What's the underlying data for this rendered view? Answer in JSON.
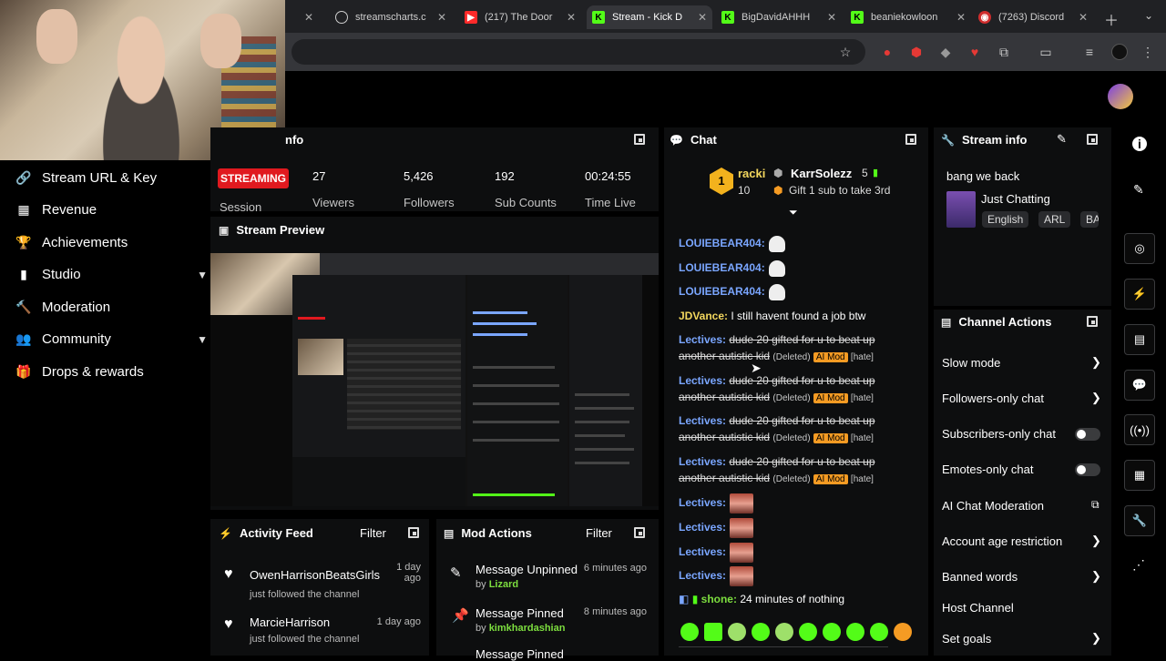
{
  "browser": {
    "tabs": [
      {
        "title": "streamscharts.c",
        "icon": "streamscharts-icon",
        "color": "#cfcfcf"
      },
      {
        "title": "(217) The Door",
        "icon": "youtube-icon",
        "color": "#ff2a2a"
      },
      {
        "title": "Stream - Kick D",
        "icon": "kick-icon",
        "color": "#53fc18"
      },
      {
        "title": "BigDavidAHHH",
        "icon": "kick-icon",
        "color": "#53fc18"
      },
      {
        "title": "beaniekowloon",
        "icon": "kick-icon",
        "color": "#53fc18"
      },
      {
        "title": "(7263) Discord",
        "icon": "discord-icon",
        "color": "#d02d2d"
      }
    ]
  },
  "sidebar": {
    "items": [
      {
        "label": "Stream URL & Key",
        "icon": "link-icon"
      },
      {
        "label": "Revenue",
        "icon": "revenue-icon"
      },
      {
        "label": "Achievements",
        "icon": "trophy-icon"
      },
      {
        "label": "Studio",
        "icon": "studio-icon",
        "chevron": true
      },
      {
        "label": "Moderation",
        "icon": "hammer-icon"
      },
      {
        "label": "Community",
        "icon": "community-icon",
        "chevron": true
      },
      {
        "label": "Drops & rewards",
        "icon": "gift-icon"
      }
    ]
  },
  "session": {
    "title_partial": "nfo",
    "badge": "STREAMING",
    "badge_label": "Session",
    "stats": [
      {
        "value": "27",
        "label": "Viewers"
      },
      {
        "value": "5,426",
        "label": "Followers"
      },
      {
        "value": "192",
        "label": "Sub Counts"
      },
      {
        "value": "00:24:55",
        "label": "Time Live"
      }
    ]
  },
  "preview": {
    "title": "Stream Preview"
  },
  "activity": {
    "title": "Activity Feed",
    "filter": "Filter",
    "items": [
      {
        "name": "OwenHarrisonBeatsGirls",
        "sub": "just followed the channel",
        "time": "1 day ago"
      },
      {
        "name": "MarcieHarrison",
        "sub": "just followed the channel",
        "time": "1 day ago"
      }
    ]
  },
  "modactions": {
    "title": "Mod Actions",
    "filter": "Filter",
    "items": [
      {
        "action": "Message Unpinned",
        "by": "by",
        "user": "Lizard",
        "time": "6 minutes ago"
      },
      {
        "action": "Message Pinned",
        "by": "by",
        "user": "kimkhardashian",
        "time": "8 minutes ago"
      },
      {
        "action": "Message Pinned",
        "by": "",
        "user": "",
        "time": ""
      }
    ]
  },
  "chat": {
    "title": "Chat",
    "top": {
      "rank": "1",
      "user1": "racki",
      "count1": "10",
      "user2": "KarrSolezz",
      "count2": "5",
      "gift_text": "Gift 1 sub to take 3rd"
    },
    "messages": [
      {
        "user": "LOUIEBEAR404:",
        "type": "ghost"
      },
      {
        "user": "LOUIEBEAR404:",
        "type": "ghost"
      },
      {
        "user": "LOUIEBEAR404:",
        "type": "ghost"
      },
      {
        "user": "JDVance:",
        "text": "I still havent found a job btw",
        "type": "text"
      },
      {
        "user": "Lectives:",
        "text": "dude 20 gifted for u to beat up another autistic kid",
        "deleted": "(Deleted)",
        "aimod": "AI Mod",
        "hate": "[hate]",
        "type": "deleted"
      },
      {
        "user": "Lectives:",
        "text": "dude 20 gifted for u to beat up another autistic kid",
        "deleted": "(Deleted)",
        "aimod": "AI Mod",
        "hate": "[hate]",
        "type": "deleted"
      },
      {
        "user": "Lectives:",
        "text": "dude 20 gifted for u to beat up another autistic kid",
        "deleted": "(Deleted)",
        "aimod": "AI Mod",
        "hate": "[hate]",
        "type": "deleted"
      },
      {
        "user": "Lectives:",
        "text": "dude 20 gifted for u to beat up another autistic kid",
        "deleted": "(Deleted)",
        "aimod": "AI Mod",
        "hate": "[hate]",
        "type": "deleted"
      },
      {
        "user": "Lectives:",
        "type": "img"
      },
      {
        "user": "Lectives:",
        "type": "img"
      },
      {
        "user": "Lectives:",
        "type": "img"
      },
      {
        "user": "Lectives:",
        "type": "img"
      },
      {
        "user": "shone:",
        "text": "24 minutes of nothing",
        "type": "text"
      }
    ]
  },
  "streaminfo": {
    "title": "Stream info",
    "stream_title": "bang we back",
    "category": "Just Chatting",
    "tags": [
      "English",
      "ARL",
      "BA"
    ]
  },
  "channelactions": {
    "title": "Channel Actions",
    "items": [
      {
        "label": "Slow mode",
        "control": "arrow"
      },
      {
        "label": "Followers-only chat",
        "control": "arrow"
      },
      {
        "label": "Subscribers-only chat",
        "control": "toggle"
      },
      {
        "label": "Emotes-only chat",
        "control": "toggle"
      },
      {
        "label": "AI Chat Moderation",
        "control": "external"
      },
      {
        "label": "Account age restriction",
        "control": "arrow"
      },
      {
        "label": "Banned words",
        "control": "arrow"
      },
      {
        "label": "Host Channel",
        "control": "none"
      },
      {
        "label": "Set goals",
        "control": "arrow"
      }
    ]
  },
  "colors": {
    "kick_green": "#53fc18",
    "streaming_red": "#e0191f",
    "ai_mod_orange": "#f59b23",
    "username_green": "#7dde3f"
  }
}
